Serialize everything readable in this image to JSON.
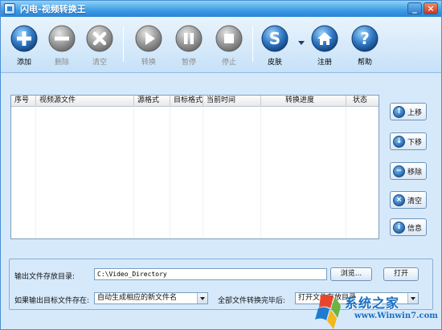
{
  "window": {
    "title": "闪电-视频转换王"
  },
  "toolbar": {
    "add": "添加",
    "delete": "删除",
    "clear": "清空",
    "convert": "转换",
    "pause": "暂停",
    "stop": "停止",
    "skin": "皮肤",
    "register": "注册",
    "help": "帮助"
  },
  "table": {
    "columns": [
      "序号",
      "视频源文件",
      "源格式",
      "目标格式",
      "当前时间",
      "转换进度",
      "状态"
    ],
    "rows": []
  },
  "side_buttons": {
    "up": "上移",
    "down": "下移",
    "remove": "移除",
    "clear": "清空",
    "info": "信息"
  },
  "output": {
    "dir_label": "输出文件存放目录:",
    "dir_value": "C:\\Video_Directory",
    "browse": "浏览...",
    "open": "打开",
    "exists_label": "如果输出目标文件存在:",
    "exists_value": "自动生成相应的新文件名",
    "complete_label": "全部文件转换完毕后:",
    "complete_value": "打开文件存放目录"
  },
  "watermark": {
    "text": "系统之家",
    "url": "www.Winwin7.com"
  },
  "colors": {
    "accent": "#2b84d6",
    "icon_blue": "#1f5fa8",
    "icon_gray": "#8c8c8c"
  }
}
